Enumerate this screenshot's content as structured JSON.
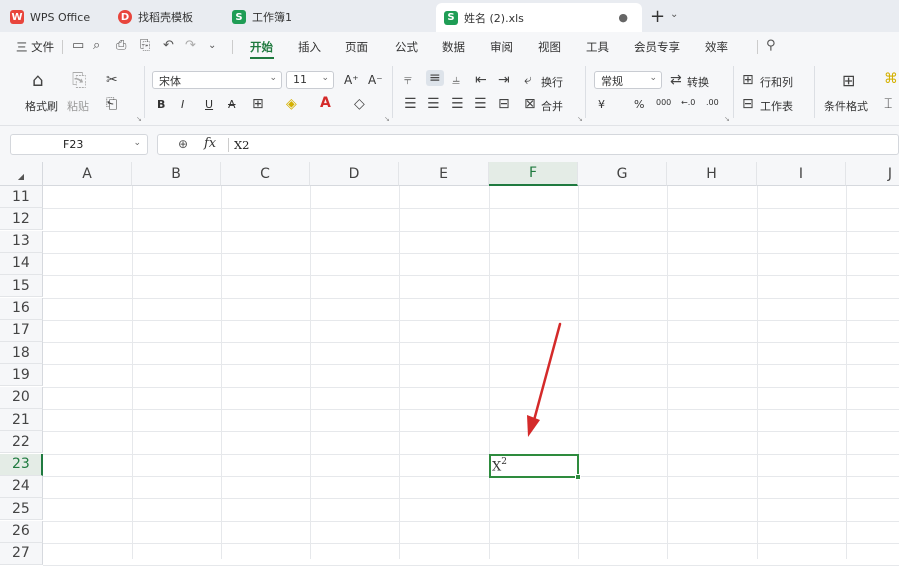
{
  "tabs": [
    {
      "label": "WPS Office",
      "icon": "wps-logo-icon",
      "color": "#e8453c"
    },
    {
      "label": "找稻壳模板",
      "icon": "daoke-icon",
      "color": "#e8453c"
    },
    {
      "label": "工作簿1",
      "icon": "sheet-icon",
      "color": "#1f9d55"
    },
    {
      "label": "姓名 (2).xls",
      "icon": "sheet-icon",
      "color": "#1f9d55",
      "active": true
    }
  ],
  "menu": {
    "file": "三 文件",
    "items": [
      "开始",
      "插入",
      "页面",
      "公式",
      "数据",
      "审阅",
      "视图",
      "工具",
      "会员专享",
      "效率"
    ],
    "active": "开始"
  },
  "ribbon": {
    "format_painter": "格式刷",
    "paste": "粘贴",
    "font_name": "宋体",
    "font_size": "11",
    "bold": "B",
    "italic": "I",
    "underline": "U",
    "strike": "A",
    "wrap": "换行",
    "number_format": "常规",
    "convert": "转换",
    "merge": "合并",
    "rows_cols": "行和列",
    "worksheet": "工作表",
    "conditional_format": "条件格式",
    "currency": "¥",
    "percent": "%"
  },
  "formula_bar": {
    "cell_ref": "F23",
    "content": "X2"
  },
  "grid": {
    "columns": [
      "A",
      "B",
      "C",
      "D",
      "E",
      "F",
      "G",
      "H",
      "I",
      "J"
    ],
    "rows": [
      "11",
      "12",
      "13",
      "14",
      "15",
      "16",
      "17",
      "18",
      "19",
      "20",
      "21",
      "22",
      "23",
      "24",
      "25",
      "26",
      "27"
    ],
    "selected_column": "F",
    "selected_row": "23",
    "cell_base": "X",
    "cell_superscript": "2"
  },
  "colors": {
    "accent": "#1f7a3f",
    "selection_border": "#2e8b3e",
    "arrow": "#d42a2a"
  }
}
